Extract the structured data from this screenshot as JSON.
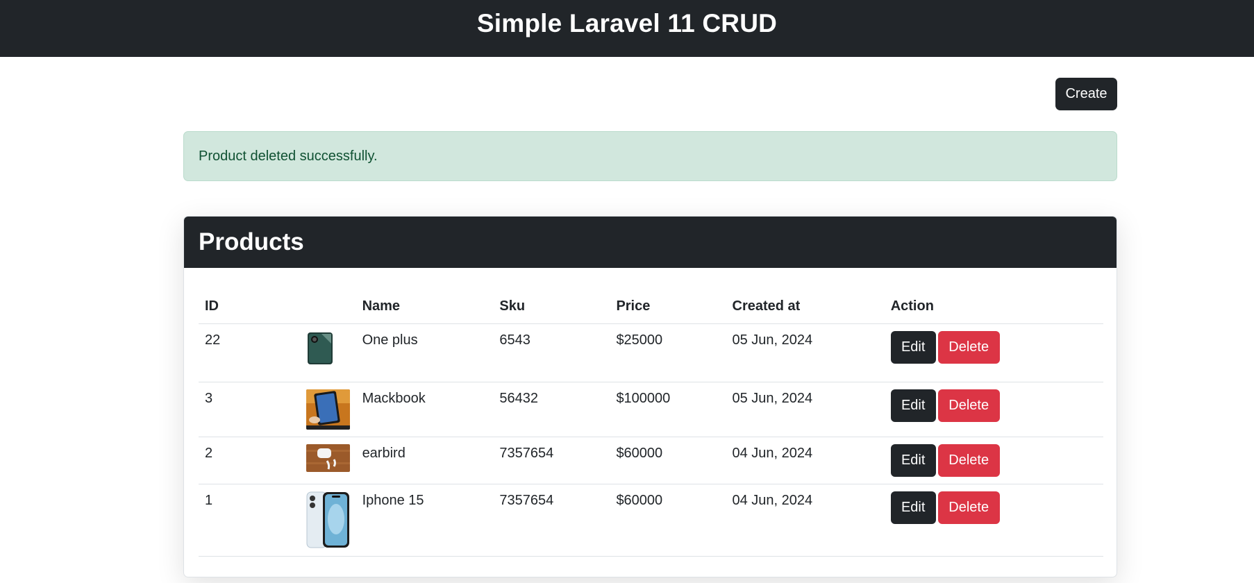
{
  "header": {
    "title": "Simple Laravel 11 CRUD"
  },
  "toolbar": {
    "create_label": "Create"
  },
  "alert": {
    "message": "Product deleted successfully."
  },
  "products_card": {
    "title": "Products",
    "columns": {
      "id": "ID",
      "image": "",
      "name": "Name",
      "sku": "Sku",
      "price": "Price",
      "created_at": "Created at",
      "action": "Action"
    },
    "rows": [
      {
        "id": "22",
        "image_icon": "phone-green-thumbnail",
        "name": "One plus",
        "sku": "6543",
        "price": "$25000",
        "created_at": "05 Jun, 2024",
        "edit_label": "Edit",
        "delete_label": "Delete"
      },
      {
        "id": "3",
        "image_icon": "tablet-thumbnail",
        "name": "Mackbook",
        "sku": "56432",
        "price": "$100000",
        "created_at": "05 Jun, 2024",
        "edit_label": "Edit",
        "delete_label": "Delete"
      },
      {
        "id": "2",
        "image_icon": "earbuds-thumbnail",
        "name": "earbird",
        "sku": "7357654",
        "price": "$60000",
        "created_at": "04 Jun, 2024",
        "edit_label": "Edit",
        "delete_label": "Delete"
      },
      {
        "id": "1",
        "image_icon": "iphone-blue-thumbnail",
        "name": "Iphone 15",
        "sku": "7357654",
        "price": "$60000",
        "created_at": "04 Jun, 2024",
        "edit_label": "Edit",
        "delete_label": "Delete"
      }
    ]
  },
  "colors": {
    "dark": "#212529",
    "danger": "#dc3545",
    "alert_bg": "#d1e7dd",
    "alert_text": "#0f5132"
  }
}
